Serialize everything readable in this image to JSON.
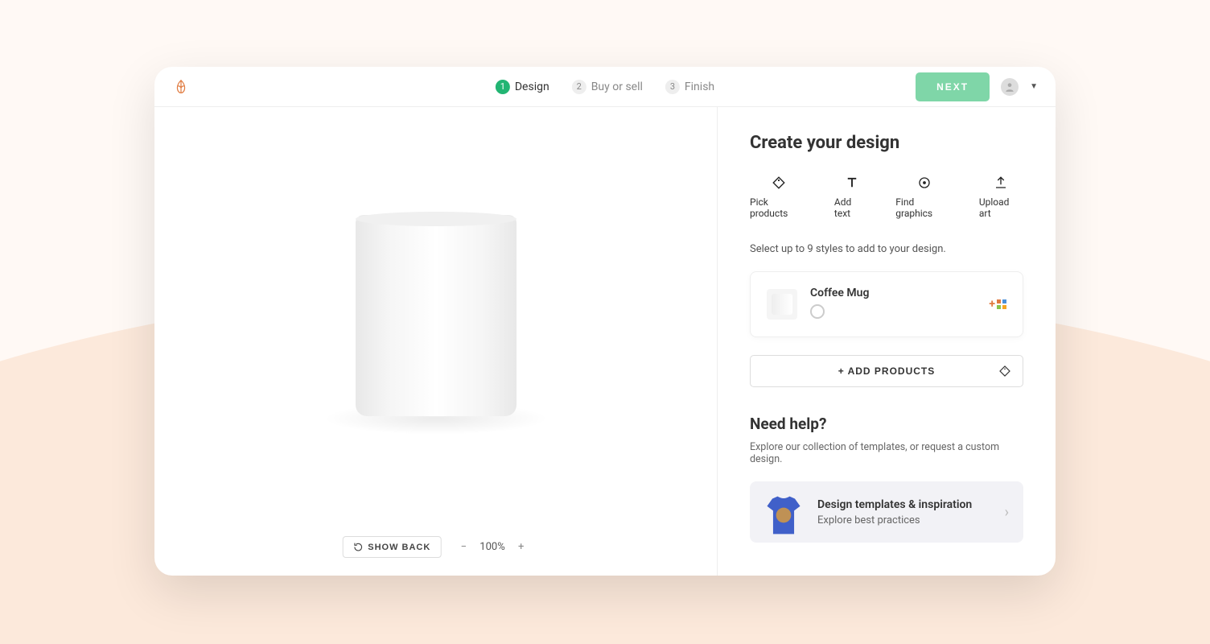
{
  "steps": [
    {
      "num": "1",
      "label": "Design",
      "active": true
    },
    {
      "num": "2",
      "label": "Buy or sell",
      "active": false
    },
    {
      "num": "3",
      "label": "Finish",
      "active": false
    }
  ],
  "header": {
    "next": "NEXT"
  },
  "canvas": {
    "show_back": "SHOW BACK",
    "zoom": "100%"
  },
  "sidebar": {
    "title": "Create your design",
    "tools": [
      {
        "label": "Pick products"
      },
      {
        "label": "Add text"
      },
      {
        "label": "Find graphics"
      },
      {
        "label": "Upload art"
      }
    ],
    "hint": "Select up to 9 styles to add to your design.",
    "product": {
      "name": "Coffee Mug"
    },
    "add_products": "+ ADD PRODUCTS",
    "help_title": "Need help?",
    "help_text": "Explore our collection of templates, or request a custom design.",
    "template": {
      "title": "Design templates & inspiration",
      "sub": "Explore best practices"
    }
  }
}
